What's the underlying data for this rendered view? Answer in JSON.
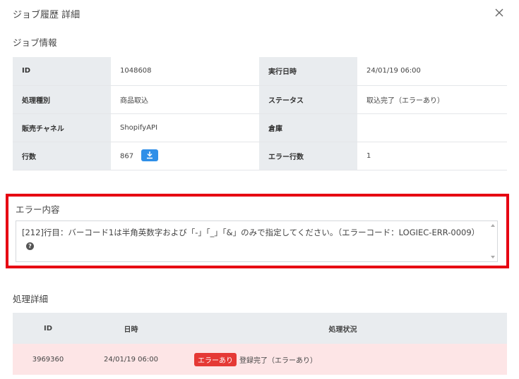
{
  "dialog": {
    "title": "ジョブ履歴 詳細",
    "close_icon": "close-icon"
  },
  "job_info": {
    "section_title": "ジョブ情報",
    "rows": [
      {
        "l1": "ID",
        "v1": "1048608",
        "l2": "実行日時",
        "v2": "24/01/19 06:00"
      },
      {
        "l1": "処理種別",
        "v1": "商品取込",
        "l2": "ステータス",
        "v2": "取込完了（エラーあり）"
      },
      {
        "l1": "販売チャネル",
        "v1": "ShopifyAPI",
        "l2": "倉庫",
        "v2": ""
      },
      {
        "l1": "行数",
        "v1": "867",
        "l2": "エラー行数",
        "v2": "1"
      }
    ],
    "download_icon": "download-icon"
  },
  "error": {
    "section_title": "エラー内容",
    "message": "[212]行目：バーコード1は半角英数字および「-」「_」「&」のみで指定してください。（エラーコード：LOGIEC-ERR-0009）",
    "help_icon": "?",
    "highlight_color": "#e60012"
  },
  "details": {
    "section_title": "処理詳細",
    "headers": [
      "ID",
      "日時",
      "処理状況"
    ],
    "rows": [
      {
        "id": "3969360",
        "datetime": "24/01/19 06:00",
        "badge": "エラーあり",
        "status": "登録完了（エラーあり）"
      }
    ],
    "badge_color": "#e53935",
    "row_bg": "#fde5e6"
  }
}
